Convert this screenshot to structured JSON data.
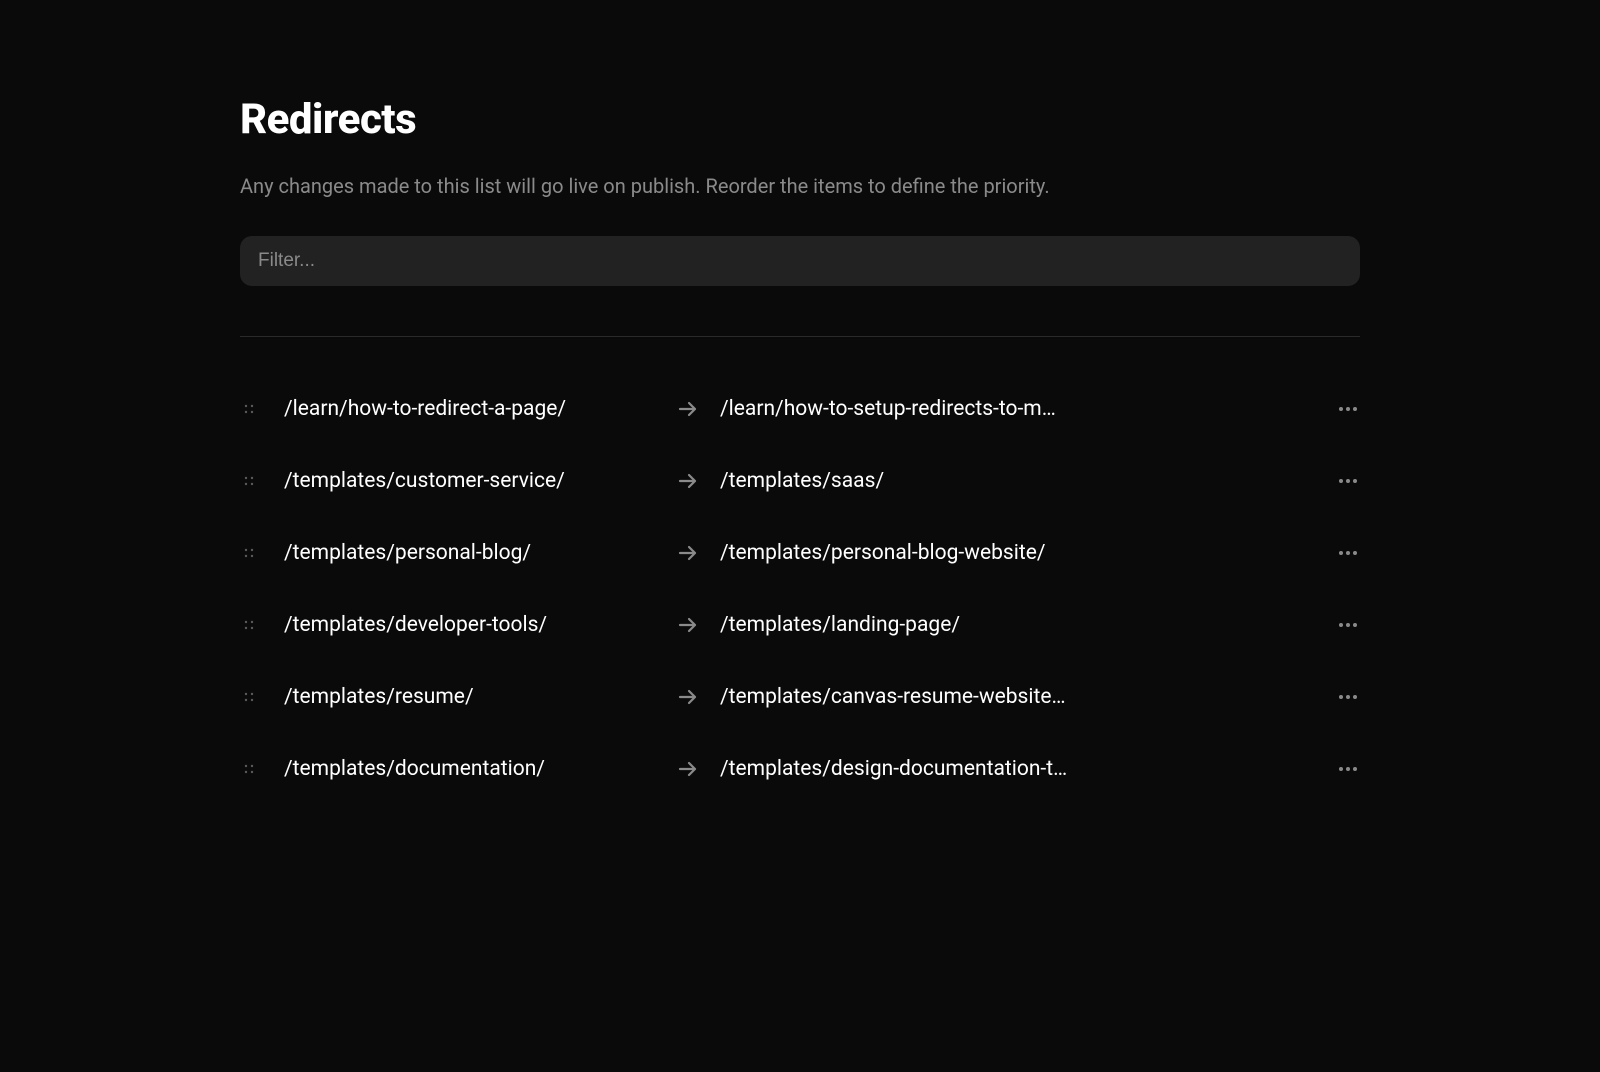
{
  "page": {
    "title": "Redirects",
    "description": "Any changes made to this list will go live on publish. Reorder the items to define the priority."
  },
  "filter": {
    "placeholder": "Filter..."
  },
  "redirects": [
    {
      "from": "/learn/how-to-redirect-a-page/",
      "to": "/learn/how-to-setup-redirects-to-m…"
    },
    {
      "from": "/templates/customer-service/",
      "to": "/templates/saas/"
    },
    {
      "from": "/templates/personal-blog/",
      "to": "/templates/personal-blog-website/"
    },
    {
      "from": "/templates/developer-tools/",
      "to": "/templates/landing-page/"
    },
    {
      "from": "/templates/resume/",
      "to": "/templates/canvas-resume-website…"
    },
    {
      "from": "/templates/documentation/",
      "to": "/templates/design-documentation-t…"
    }
  ]
}
